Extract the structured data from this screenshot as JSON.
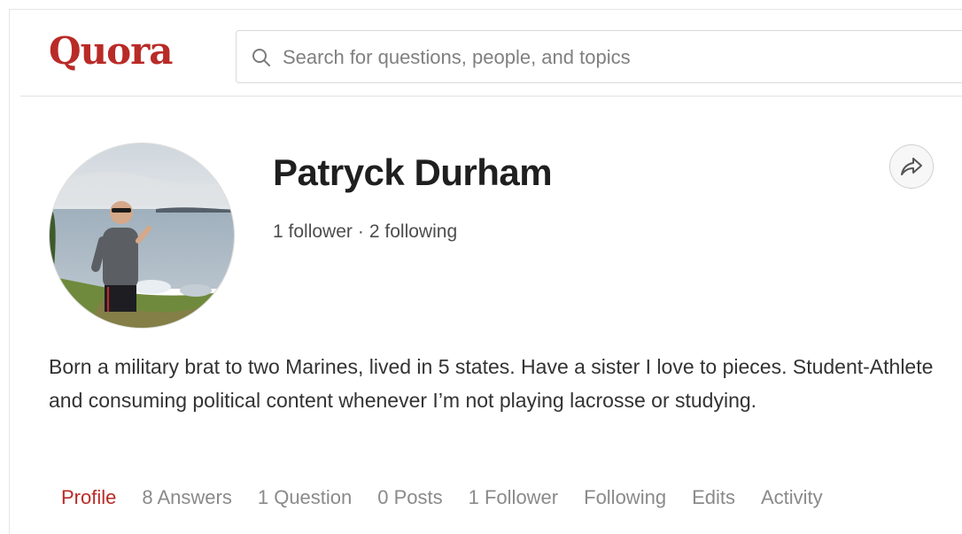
{
  "header": {
    "logo": "Quora",
    "search_placeholder": "Search for questions, people, and topics"
  },
  "profile": {
    "name": "Patryck Durham",
    "followers": "1 follower",
    "separator": "·",
    "following": "2 following",
    "bio": "Born a military brat to two Marines, lived in 5 states. Have a sister I love to pieces. Student-Athlete and consuming political content whenever I’m not playing lacrosse or studying."
  },
  "tabs": [
    {
      "label": "Profile",
      "active": true
    },
    {
      "label": "8 Answers",
      "active": false
    },
    {
      "label": "1 Question",
      "active": false
    },
    {
      "label": "0 Posts",
      "active": false
    },
    {
      "label": "1 Follower",
      "active": false
    },
    {
      "label": "Following",
      "active": false
    },
    {
      "label": "Edits",
      "active": false
    },
    {
      "label": "Activity",
      "active": false
    }
  ],
  "colors": {
    "brand": "#b92b27",
    "text": "#333333",
    "muted": "#8a8a8a"
  },
  "icons": {
    "search": "search-icon",
    "share": "share-icon",
    "avatar": "profile-photo"
  }
}
